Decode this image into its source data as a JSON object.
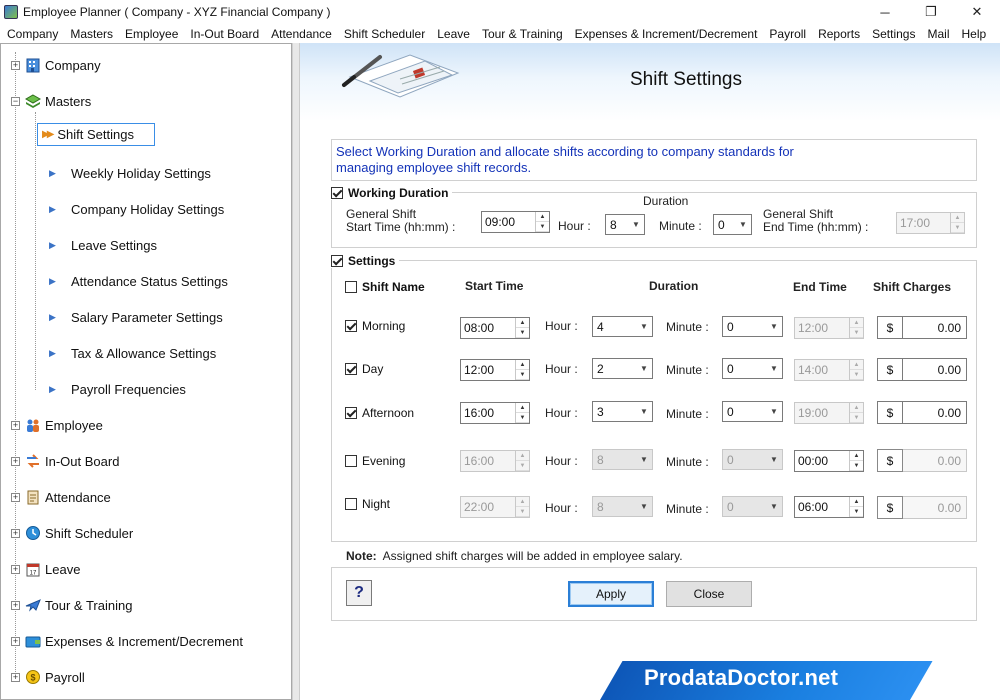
{
  "window": {
    "title": "Employee Planner ( Company - XYZ Financial Company )",
    "minimize": "─",
    "restore": "❐",
    "close": "✕"
  },
  "menu": [
    "Company",
    "Masters",
    "Employee",
    "In-Out Board",
    "Attendance",
    "Shift Scheduler",
    "Leave",
    "Tour & Training",
    "Expenses & Increment/Decrement",
    "Payroll",
    "Reports",
    "Settings",
    "Mail",
    "Help"
  ],
  "tree": {
    "company": "Company",
    "masters": "Masters",
    "masters_children": [
      "Shift Settings",
      "Weekly Holiday Settings",
      "Company Holiday Settings",
      "Leave Settings",
      "Attendance Status Settings",
      "Salary Parameter Settings",
      "Tax & Allowance Settings",
      "Payroll Frequencies"
    ],
    "employee": "Employee",
    "inout": "In-Out Board",
    "attendance": "Attendance",
    "shift_scheduler": "Shift Scheduler",
    "leave": "Leave",
    "tour": "Tour & Training",
    "expenses": "Expenses & Increment/Decrement",
    "payroll": "Payroll"
  },
  "page": {
    "title": "Shift Settings",
    "info": "Select Working Duration and allocate shifts according to company standards for managing employee shift records."
  },
  "working_duration": {
    "label": "Working Duration",
    "checked": true,
    "duration_heading": "Duration",
    "start_label_1": "General Shift",
    "start_label_2": "Start Time (hh:mm) :",
    "start_value": "09:00",
    "hour_label": "Hour :",
    "hour_value": "8",
    "minute_label": "Minute :",
    "minute_value": "0",
    "end_label_1": "General Shift",
    "end_label_2": "End Time (hh:mm) :",
    "end_value": "17:00"
  },
  "settings": {
    "label": "Settings",
    "headers": {
      "shift_name": "Shift Name",
      "start_time": "Start Time",
      "duration": "Duration",
      "end_time": "End Time",
      "charges": "Shift Charges"
    },
    "hour_label": "Hour :",
    "minute_label": "Minute :",
    "currency": "$",
    "shifts": [
      {
        "name": "Morning",
        "checked": true,
        "start": "08:00",
        "hour": "4",
        "minute": "0",
        "end": "12:00",
        "charge": "0.00"
      },
      {
        "name": "Day",
        "checked": true,
        "start": "12:00",
        "hour": "2",
        "minute": "0",
        "end": "14:00",
        "charge": "0.00"
      },
      {
        "name": "Afternoon",
        "checked": true,
        "start": "16:00",
        "hour": "3",
        "minute": "0",
        "end": "19:00",
        "charge": "0.00"
      },
      {
        "name": "Evening",
        "checked": false,
        "start": "16:00",
        "hour": "8",
        "minute": "0",
        "end": "00:00",
        "charge": "0.00"
      },
      {
        "name": "Night",
        "checked": false,
        "start": "22:00",
        "hour": "8",
        "minute": "0",
        "end": "06:00",
        "charge": "0.00"
      }
    ]
  },
  "note": {
    "label": "Note:",
    "text": "Assigned shift charges will be added in employee salary."
  },
  "buttons": {
    "help": "?",
    "apply": "Apply",
    "close": "Close"
  },
  "brand": "ProdataDoctor.net",
  "colors": {
    "accent": "#2b7fd6",
    "info_text": "#1433b8",
    "brand_blue": "#0e57b8"
  }
}
